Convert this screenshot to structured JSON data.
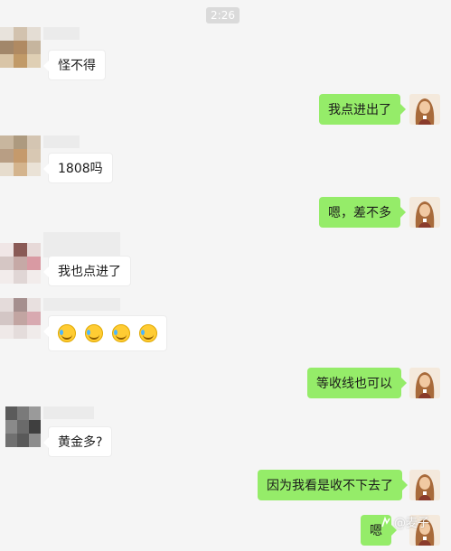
{
  "time": "2:26",
  "messages": {
    "m1": "怪不得",
    "m2": "我点进出了",
    "m3": "1808吗",
    "m4": "嗯，差不多",
    "m5": "我也点进了",
    "m7": "等收线也可以",
    "m8": "黄金多?",
    "m9": "因为我看是收不下去了",
    "m10": "嗯"
  },
  "emoji_reactions": [
    "laugh-cry-emoji",
    "laugh-cry-emoji",
    "laugh-cry-emoji",
    "laugh-cry-emoji"
  ],
  "watermark": {
    "text": "@麦子",
    "icon": "watermark-logo-icon"
  },
  "colors": {
    "outgoing_bubble": "#95ec69",
    "incoming_bubble": "#ffffff",
    "background": "#f5f5f5",
    "timestamp_bg": "#dadada"
  }
}
